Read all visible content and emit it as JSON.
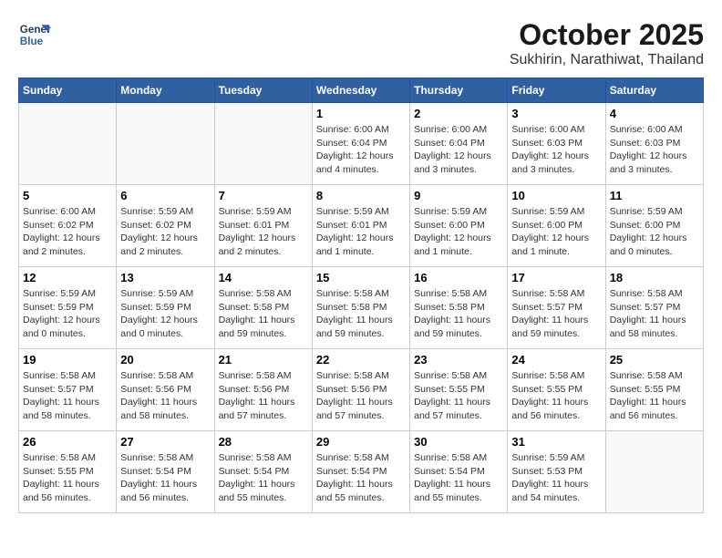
{
  "header": {
    "logo_line1": "General",
    "logo_line2": "Blue",
    "month_title": "October 2025",
    "subtitle": "Sukhirin, Narathiwat, Thailand"
  },
  "weekdays": [
    "Sunday",
    "Monday",
    "Tuesday",
    "Wednesday",
    "Thursday",
    "Friday",
    "Saturday"
  ],
  "weeks": [
    [
      {
        "day": "",
        "info": ""
      },
      {
        "day": "",
        "info": ""
      },
      {
        "day": "",
        "info": ""
      },
      {
        "day": "1",
        "info": "Sunrise: 6:00 AM\nSunset: 6:04 PM\nDaylight: 12 hours\nand 4 minutes."
      },
      {
        "day": "2",
        "info": "Sunrise: 6:00 AM\nSunset: 6:04 PM\nDaylight: 12 hours\nand 3 minutes."
      },
      {
        "day": "3",
        "info": "Sunrise: 6:00 AM\nSunset: 6:03 PM\nDaylight: 12 hours\nand 3 minutes."
      },
      {
        "day": "4",
        "info": "Sunrise: 6:00 AM\nSunset: 6:03 PM\nDaylight: 12 hours\nand 3 minutes."
      }
    ],
    [
      {
        "day": "5",
        "info": "Sunrise: 6:00 AM\nSunset: 6:02 PM\nDaylight: 12 hours\nand 2 minutes."
      },
      {
        "day": "6",
        "info": "Sunrise: 5:59 AM\nSunset: 6:02 PM\nDaylight: 12 hours\nand 2 minutes."
      },
      {
        "day": "7",
        "info": "Sunrise: 5:59 AM\nSunset: 6:01 PM\nDaylight: 12 hours\nand 2 minutes."
      },
      {
        "day": "8",
        "info": "Sunrise: 5:59 AM\nSunset: 6:01 PM\nDaylight: 12 hours\nand 1 minute."
      },
      {
        "day": "9",
        "info": "Sunrise: 5:59 AM\nSunset: 6:00 PM\nDaylight: 12 hours\nand 1 minute."
      },
      {
        "day": "10",
        "info": "Sunrise: 5:59 AM\nSunset: 6:00 PM\nDaylight: 12 hours\nand 1 minute."
      },
      {
        "day": "11",
        "info": "Sunrise: 5:59 AM\nSunset: 6:00 PM\nDaylight: 12 hours\nand 0 minutes."
      }
    ],
    [
      {
        "day": "12",
        "info": "Sunrise: 5:59 AM\nSunset: 5:59 PM\nDaylight: 12 hours\nand 0 minutes."
      },
      {
        "day": "13",
        "info": "Sunrise: 5:59 AM\nSunset: 5:59 PM\nDaylight: 12 hours\nand 0 minutes."
      },
      {
        "day": "14",
        "info": "Sunrise: 5:58 AM\nSunset: 5:58 PM\nDaylight: 11 hours\nand 59 minutes."
      },
      {
        "day": "15",
        "info": "Sunrise: 5:58 AM\nSunset: 5:58 PM\nDaylight: 11 hours\nand 59 minutes."
      },
      {
        "day": "16",
        "info": "Sunrise: 5:58 AM\nSunset: 5:58 PM\nDaylight: 11 hours\nand 59 minutes."
      },
      {
        "day": "17",
        "info": "Sunrise: 5:58 AM\nSunset: 5:57 PM\nDaylight: 11 hours\nand 59 minutes."
      },
      {
        "day": "18",
        "info": "Sunrise: 5:58 AM\nSunset: 5:57 PM\nDaylight: 11 hours\nand 58 minutes."
      }
    ],
    [
      {
        "day": "19",
        "info": "Sunrise: 5:58 AM\nSunset: 5:57 PM\nDaylight: 11 hours\nand 58 minutes."
      },
      {
        "day": "20",
        "info": "Sunrise: 5:58 AM\nSunset: 5:56 PM\nDaylight: 11 hours\nand 58 minutes."
      },
      {
        "day": "21",
        "info": "Sunrise: 5:58 AM\nSunset: 5:56 PM\nDaylight: 11 hours\nand 57 minutes."
      },
      {
        "day": "22",
        "info": "Sunrise: 5:58 AM\nSunset: 5:56 PM\nDaylight: 11 hours\nand 57 minutes."
      },
      {
        "day": "23",
        "info": "Sunrise: 5:58 AM\nSunset: 5:55 PM\nDaylight: 11 hours\nand 57 minutes."
      },
      {
        "day": "24",
        "info": "Sunrise: 5:58 AM\nSunset: 5:55 PM\nDaylight: 11 hours\nand 56 minutes."
      },
      {
        "day": "25",
        "info": "Sunrise: 5:58 AM\nSunset: 5:55 PM\nDaylight: 11 hours\nand 56 minutes."
      }
    ],
    [
      {
        "day": "26",
        "info": "Sunrise: 5:58 AM\nSunset: 5:55 PM\nDaylight: 11 hours\nand 56 minutes."
      },
      {
        "day": "27",
        "info": "Sunrise: 5:58 AM\nSunset: 5:54 PM\nDaylight: 11 hours\nand 56 minutes."
      },
      {
        "day": "28",
        "info": "Sunrise: 5:58 AM\nSunset: 5:54 PM\nDaylight: 11 hours\nand 55 minutes."
      },
      {
        "day": "29",
        "info": "Sunrise: 5:58 AM\nSunset: 5:54 PM\nDaylight: 11 hours\nand 55 minutes."
      },
      {
        "day": "30",
        "info": "Sunrise: 5:58 AM\nSunset: 5:54 PM\nDaylight: 11 hours\nand 55 minutes."
      },
      {
        "day": "31",
        "info": "Sunrise: 5:59 AM\nSunset: 5:53 PM\nDaylight: 11 hours\nand 54 minutes."
      },
      {
        "day": "",
        "info": ""
      }
    ]
  ]
}
